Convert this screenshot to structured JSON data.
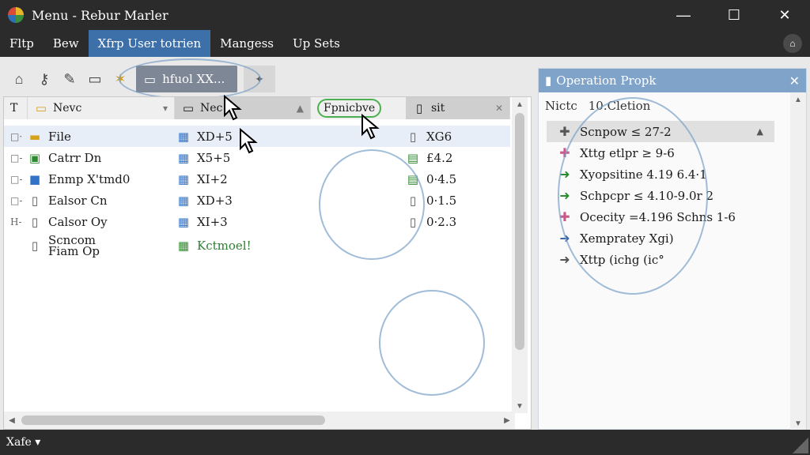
{
  "window": {
    "title": "Menu -  Rebur Marler",
    "controls": {
      "minimize": "—",
      "maximize": "☐",
      "close": "✕"
    }
  },
  "menubar": {
    "items": [
      {
        "label": "Fltp",
        "active": false
      },
      {
        "label": "Bew",
        "active": false
      },
      {
        "label": "Xfrp User totrien",
        "active": true
      },
      {
        "label": "Mangess",
        "active": false
      },
      {
        "label": "Up Sets",
        "active": false
      }
    ]
  },
  "toolbar": {
    "icons": [
      "home-icon",
      "key-icon",
      "pencil-icon",
      "speech-icon",
      "star-icon"
    ],
    "tab_label": "hfuol XX...",
    "pin_glyph": "✦"
  },
  "list": {
    "headers": {
      "col1": "Nevc",
      "col2": "Nec",
      "col3": "Fpnicbve",
      "col4": "sit"
    },
    "rows": [
      {
        "exp": "□·",
        "icon": "folder-icon",
        "name": "File",
        "code_icon": "sheet-icon",
        "code": "XD+5",
        "val_icon": "doc-icon",
        "val": "XG6",
        "selected": true
      },
      {
        "exp": "□-",
        "icon": "sheet-icon",
        "name": "Catrr Dn",
        "code_icon": "sheet-icon",
        "code": "X5+5",
        "val_icon": "sheet-icon",
        "val": "£4.2",
        "selected": false
      },
      {
        "exp": "□-",
        "icon": "box-icon",
        "name": "Enmp X'tmd0",
        "code_icon": "sheet-icon",
        "code": "XI+2",
        "val_icon": "sheet-icon",
        "val": "0·4.5",
        "selected": false
      },
      {
        "exp": "□-",
        "icon": "doc-icon",
        "name": "Ealsor Cn",
        "code_icon": "sheet-icon",
        "code": "XD+3",
        "val_icon": "doc-icon",
        "val": "0·1.5",
        "selected": false
      },
      {
        "exp": "H-",
        "icon": "doc-icon",
        "name": "Calsor Oy",
        "code_icon": "sheet-icon",
        "code": "XI+3",
        "val_icon": "doc-icon",
        "val": "0·2.3",
        "selected": false
      },
      {
        "exp": "",
        "icon": "doc-icon",
        "name": "Scncom Fiam Op",
        "code_icon": "sheet-icon",
        "code": "Kctmoel!",
        "val_icon": "",
        "val": "",
        "selected": false
      }
    ]
  },
  "props": {
    "title": "Operation Propk",
    "sub_label": "Nictc",
    "sub_title": "10.Cletion",
    "items": [
      {
        "icon": "cross-icon",
        "color": "muted",
        "text": "Scnpow ≤ 27-2",
        "tail": "▲",
        "selected": true
      },
      {
        "icon": "cross-icon",
        "color": "pink",
        "text": "Xttg etlpr ≥ 9-6",
        "tail": "",
        "selected": false
      },
      {
        "icon": "arrow-icon",
        "color": "green",
        "text": "Xyopsitine 4.19 6.4·1",
        "tail": "",
        "selected": false
      },
      {
        "icon": "arrow-icon",
        "color": "green",
        "text": "Schpcpr ≤ 4.10-9.0r 2",
        "tail": "",
        "selected": false
      },
      {
        "icon": "cross-icon",
        "color": "pink",
        "text": "Ocecity =4.196 Schns 1-6",
        "tail": "",
        "selected": false
      },
      {
        "icon": "arrow-icon",
        "color": "blue",
        "text": "Xempratey Xgi)",
        "tail": "",
        "selected": false
      },
      {
        "icon": "arrow-icon",
        "color": "muted",
        "text": "Xttp (ichg (ic°",
        "tail": "",
        "selected": false
      }
    ]
  },
  "statusbar": {
    "label": "Xafe ▾"
  }
}
